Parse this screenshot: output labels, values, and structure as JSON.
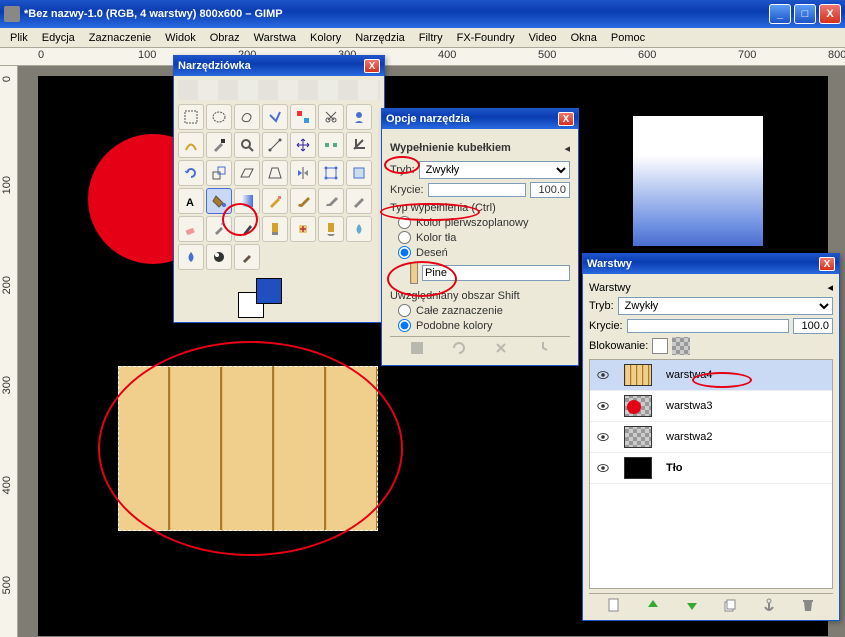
{
  "window": {
    "title": "*Bez nazwy-1.0 (RGB, 4 warstwy) 800x600 – GIMP"
  },
  "menu": {
    "items": [
      "Plik",
      "Edycja",
      "Zaznaczenie",
      "Widok",
      "Obraz",
      "Warstwa",
      "Kolory",
      "Narzędzia",
      "Filtry",
      "FX-Foundry",
      "Video",
      "Okna",
      "Pomoc"
    ]
  },
  "ruler": {
    "h": [
      "0",
      "100",
      "200",
      "300",
      "400",
      "500",
      "600",
      "700",
      "800"
    ],
    "v": [
      "0",
      "100",
      "200",
      "300",
      "400",
      "500"
    ]
  },
  "toolbox": {
    "title": "Narzędziówka"
  },
  "tool_options": {
    "title": "Opcje narzędzia",
    "heading": "Wypełnienie kubełkiem",
    "mode_label": "Tryb:",
    "mode_value": "Zwykły",
    "opacity_label": "Krycie:",
    "opacity_value": "100.0",
    "fill_type_label": "Typ wypełnienia (Ctrl)",
    "fg_label": "Kolor pierwszoplanowy",
    "bg_label": "Kolor tła",
    "pattern_label": "Deseń",
    "pattern_name": "Pine",
    "affected_label": "Uwzględniany obszar Shift",
    "whole_sel_label": "Całe zaznaczenie",
    "similar_label": "Podobne kolory"
  },
  "layers": {
    "title": "Warstwy",
    "section": "Warstwy",
    "mode_label": "Tryb:",
    "mode_value": "Zwykły",
    "opacity_label": "Krycie:",
    "opacity_value": "100.0",
    "lock_label": "Blokowanie:",
    "items": [
      {
        "name": "warstwa4"
      },
      {
        "name": "warstwa3"
      },
      {
        "name": "warstwa2"
      },
      {
        "name": "Tło"
      }
    ]
  }
}
